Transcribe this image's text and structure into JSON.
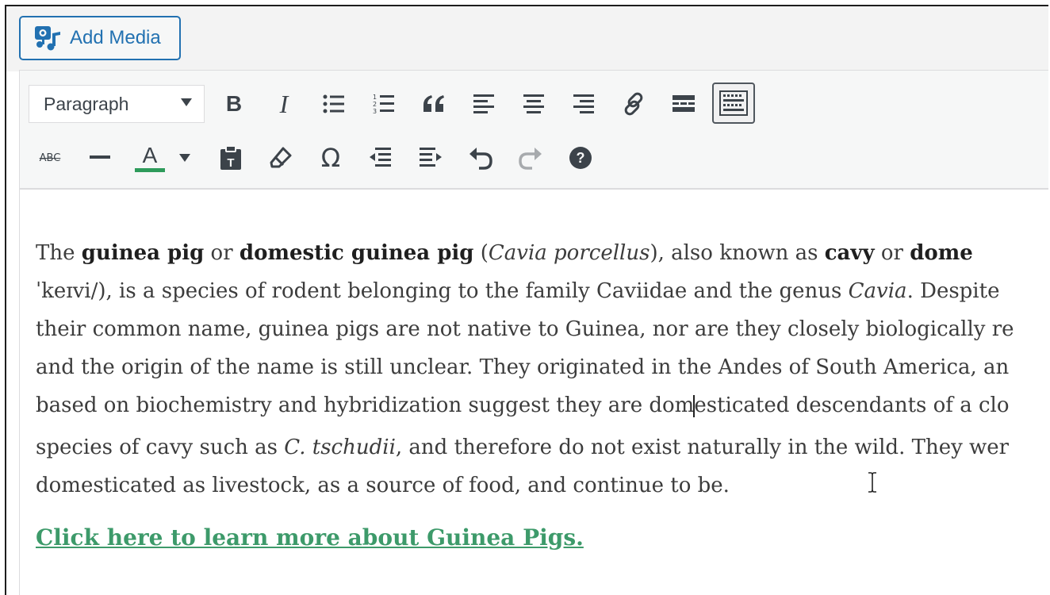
{
  "media": {
    "add_media_label": "Add Media"
  },
  "toolbar": {
    "format_select": "Paragraph",
    "row1_icons": [
      "bold-icon",
      "italic-icon",
      "bulleted-list-icon",
      "numbered-list-icon",
      "blockquote-icon",
      "align-left-icon",
      "align-center-icon",
      "align-right-icon",
      "insert-link-icon",
      "read-more-icon",
      "toolbar-toggle-icon"
    ],
    "row2_icons": [
      "strikethrough-icon",
      "horizontal-line-icon",
      "text-color-icon",
      "text-color-dropdown-icon",
      "paste-as-text-icon",
      "clear-formatting-icon",
      "special-character-icon",
      "decrease-indent-icon",
      "increase-indent-icon",
      "undo-icon",
      "redo-icon",
      "keyboard-shortcuts-icon"
    ],
    "bold_glyph": "B",
    "italic_glyph": "I",
    "strike_glyph": "ABC",
    "textcolor_glyph": "A",
    "omega_glyph": "Ω",
    "quote_glyph": "“"
  },
  "colors": {
    "accent": "#2271b1",
    "link": "#3d9a6a",
    "text_color_bar": "#2e9b5b"
  },
  "content": {
    "l1": {
      "a": "The ",
      "b": "guinea pig",
      "c": " or ",
      "d": "domestic guinea pig",
      "e": " (",
      "f": "Cavia porcellus",
      "g": "), also known as ",
      "h": "cavy",
      "i": " or ",
      "j": "dome"
    },
    "l2": {
      "a": "ˈkeɪvi/), is a species of rodent belonging to the family Caviidae and the genus ",
      "b": "Cavia",
      "c": ". Despite"
    },
    "l3": "their common name, guinea pigs are not native to Guinea, nor are they closely biologically re",
    "l4": "and the origin of the name is still unclear. They originated in the Andes of South America, an",
    "l5": {
      "a": "based on biochemistry and hybridization suggest they are dom",
      "b": "esticated descendants of a clo"
    },
    "l6": {
      "a": "species of cavy such as ",
      "b": "C. tschudii",
      "c": ", and therefore do not exist naturally in the wild. They wer"
    },
    "l7": "domesticated as livestock, as a source of food, and continue to be.",
    "link": "Click here to learn more about Guinea Pigs."
  }
}
